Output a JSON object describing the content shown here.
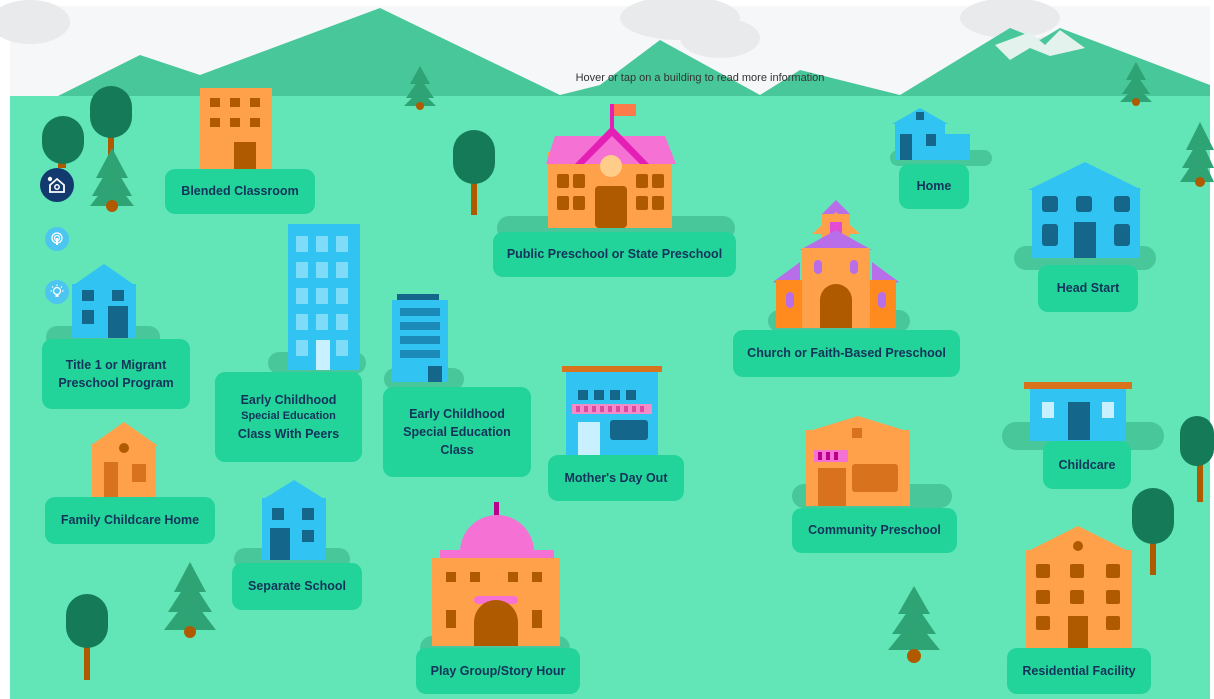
{
  "instruction": "Hover or tap on a building to read more information",
  "buildings": {
    "blended": "Blended Classroom",
    "public_pre_k": "Public Preschool or State Preschool",
    "home": "Home",
    "head_start": "Head Start",
    "title1_line1": "Title 1 or Migrant",
    "title1_line2": "Preschool Program",
    "ecse_peers_line1": "Early Childhood",
    "ecse_peers_line2": "Special Education",
    "ecse_peers_line3": "Class With Peers",
    "ecse_line1": "Early Childhood",
    "ecse_line2": "Special Education",
    "ecse_line3": "Class",
    "church": "Church or Faith-Based Preschool",
    "childcare": "Childcare",
    "mothers_day_out": "Mother's Day Out",
    "family_childcare": "Family Childcare Home",
    "separate_school": "Separate School",
    "community_preschool": "Community Preschool",
    "play_group": "Play Group/Story Hour",
    "residential": "Residential Facility"
  },
  "tools": [
    {
      "name": "accessibility-settings",
      "icon": "house-gear-icon",
      "color": "#123a6e"
    },
    {
      "name": "audio",
      "icon": "podcast-icon",
      "color": "#4cc6f0"
    },
    {
      "name": "tips",
      "icon": "lightbulb-icon",
      "color": "#4cc6f0"
    }
  ],
  "colors": {
    "grass": "#62e6b8",
    "mountain": "#48c79a",
    "label_bg": "#23d49a",
    "label_text": "#12345a",
    "orange": "#ffa14b",
    "blue": "#31c4f2",
    "pink": "#f571d4",
    "tree": "#157a58",
    "trunk": "#b05a00"
  }
}
